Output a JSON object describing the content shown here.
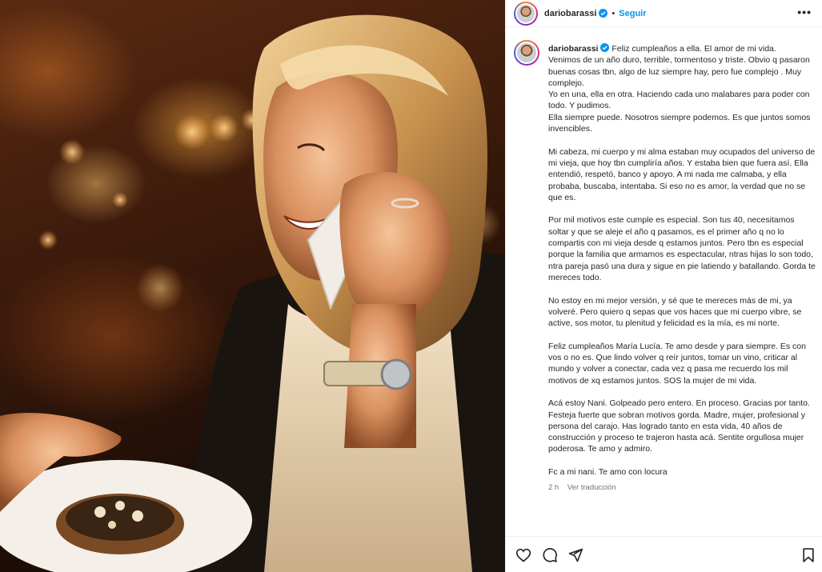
{
  "post": {
    "username": "dariobarassi",
    "follow_label": "Seguir",
    "separator": "•",
    "more_label": "•••",
    "caption_lead": "Feliz cumpleaños a ella. El amor de mi vida.",
    "caption_lines": [
      "Venimos de un año duro, terrible, tormentoso y triste. Obvio q pasaron buenas cosas tbn, algo de luz siempre hay, pero fue complejo . Muy complejo.",
      "Yo en una, ella en otra. Haciendo cada uno malabares para poder con todo. Y pudimos.",
      "Ella siempre puede. Nosotros siempre podemos. Es que juntos somos invencibles."
    ],
    "paragraphs": [
      "Mi cabeza, mi cuerpo y mi alma estaban muy ocupados del universo de mi vieja, que hoy tbn cumpliría años. Y estaba bien que fuera así. Ella entendió, respetó, banco y apoyo. A mi nada me calmaba, y ella probaba, buscaba, intentaba. Si eso no es amor, la verdad que no se que es.",
      "Por mil motivos este cumple es especial. Son tus 40, necesitamos soltar y que se aleje el año q pasamos, es el primer año q no lo compartis con mi vieja desde q estamos juntos. Pero tbn es especial porque la familia que armamos es espectacular, ntras hijas lo son todo, ntra pareja pasó una dura y sigue en pie latiendo y batallando. Gorda te mereces todo.",
      "No estoy en mi mejor versión, y sé que te mereces más de mi, ya volveré. Pero quiero q sepas que vos haces que mi cuerpo vibre, se active, sos motor, tu plenitud y felicidad es la mía, es mi norte.",
      "Feliz cumpleaños María Lucía. Te amo desde y para siempre. Es con vos o no es. Que lindo volver q reír juntos, tomar un vino, criticar al mundo y volver a conectar, cada vez q pasa me recuerdo los mil motivos de xq estamos juntos. SOS la mujer de mi vida.",
      "Acá estoy Nani. Golpeado pero entero. En proceso. Gracias por tanto. Festeja fuerte que sobran motivos gorda. Madre, mujer, profesional y persona del carajo. Has logrado tanto en esta vida, 40 años de construcción y proceso te trajeron hasta acá. Sentite orgullosa mujer poderosa. Te amo y admiro.",
      "Fc a mi nani. Te amo con locura"
    ],
    "time_ago": "2 h",
    "translate_label": "Ver traducción"
  },
  "icons": {
    "like": "heart-icon",
    "comment": "comment-icon",
    "share": "share-icon",
    "save": "bookmark-icon",
    "verified": "verified-badge-icon"
  },
  "colors": {
    "accent": "#0095f6",
    "verified": "#0095f6",
    "text": "#262626",
    "muted": "#737373"
  }
}
